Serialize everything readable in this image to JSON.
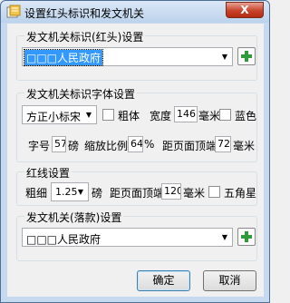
{
  "window": {
    "title": "设置红头标识和发文机关",
    "close_label": "X"
  },
  "header_group": {
    "legend": "发文机关标识(红头)设置",
    "value": "□□□人民政府"
  },
  "font_group": {
    "legend": "发文机关标识字体设置",
    "font_value": "方正小标宋",
    "bold_label": "粗体",
    "bold_checked": false,
    "width_label": "宽度",
    "width_value": "146",
    "width_unit": "毫米",
    "blue_label": "蓝色",
    "blue_checked": false,
    "size_label": "字号",
    "size_value": "57",
    "size_unit": "磅",
    "scale_label": "缩放比例",
    "scale_value": "64",
    "scale_unit": "%",
    "top_label": "距页面顶端",
    "top_value": "72",
    "top_unit": "毫米"
  },
  "line_group": {
    "legend": "红线设置",
    "thickness_label": "粗细",
    "thickness_value": "1.25",
    "thickness_unit": "磅",
    "top_label": "距页面顶端",
    "top_value": "120",
    "top_unit": "毫米",
    "star_label": "五角星",
    "star_checked": false
  },
  "sign_group": {
    "legend": "发文机关(落款)设置",
    "value": "□□□人民政府"
  },
  "buttons": {
    "ok": "确定",
    "cancel": "取消"
  },
  "colors": {
    "plus_icon": "#2e9a3a",
    "title_icon": "#e0a020",
    "accent": "#3399ff"
  }
}
